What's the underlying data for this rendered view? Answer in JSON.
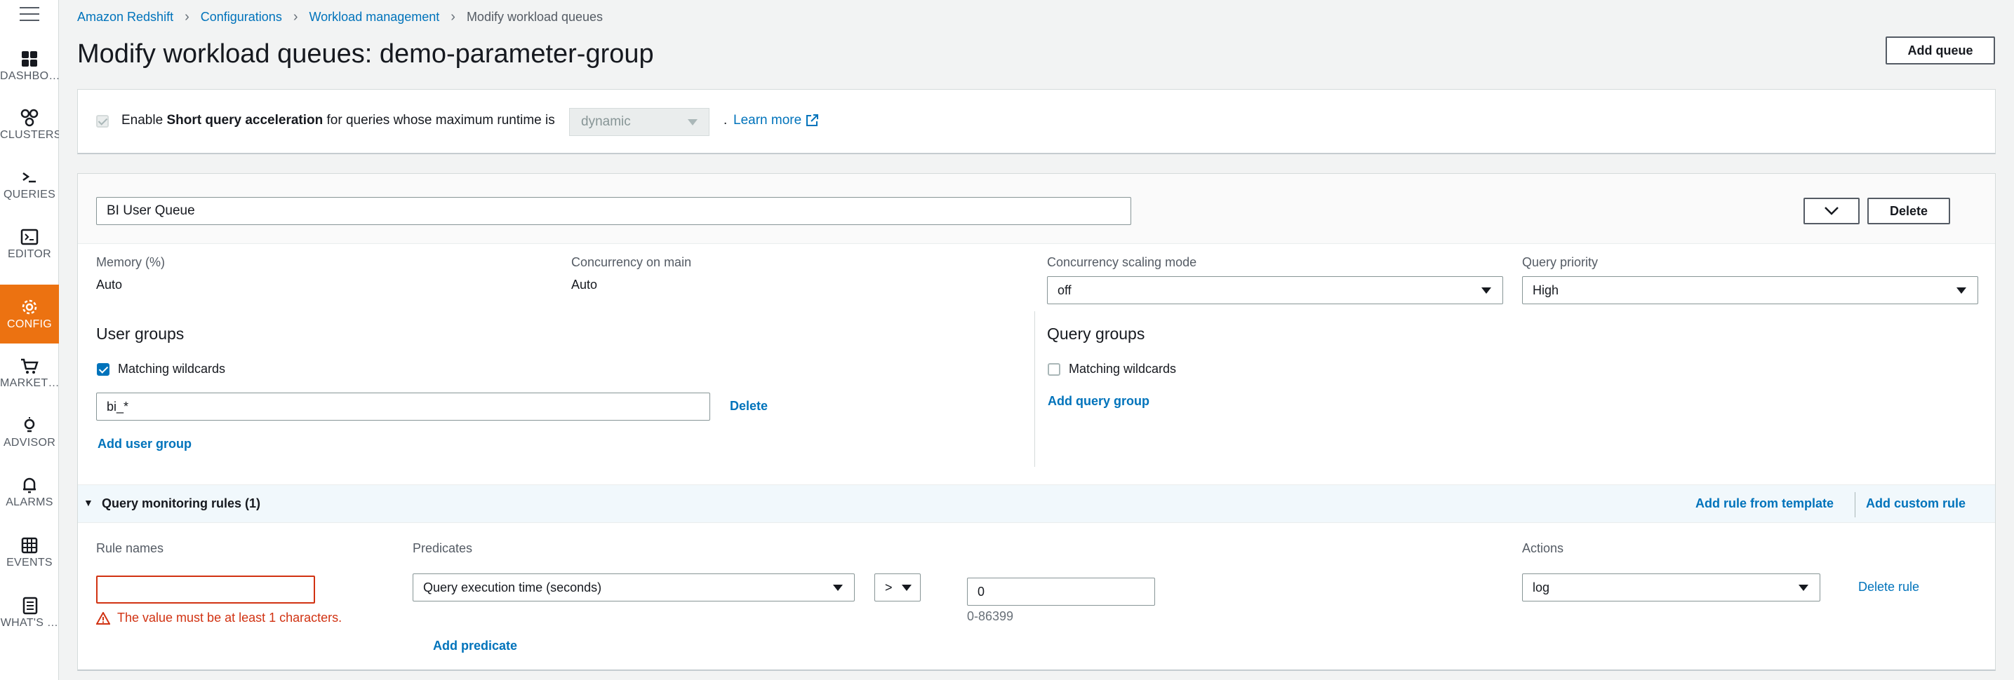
{
  "sidebar": {
    "items": [
      {
        "label": "DASHBO…",
        "icon": "dashboard-icon"
      },
      {
        "label": "CLUSTERS",
        "icon": "clusters-icon"
      },
      {
        "label": "QUERIES",
        "icon": "queries-icon"
      },
      {
        "label": "EDITOR",
        "icon": "editor-icon"
      },
      {
        "label": "CONFIG",
        "icon": "config-gear-icon",
        "active": true
      },
      {
        "label": "MARKET…",
        "icon": "marketplace-cart-icon"
      },
      {
        "label": "ADVISOR",
        "icon": "advisor-bulb-icon"
      },
      {
        "label": "ALARMS",
        "icon": "alarms-bell-icon"
      },
      {
        "label": "EVENTS",
        "icon": "events-calendar-icon"
      },
      {
        "label": "WHAT'S …",
        "icon": "whats-new-icon"
      }
    ]
  },
  "breadcrumb": {
    "items": [
      "Amazon Redshift",
      "Configurations",
      "Workload management"
    ],
    "current": "Modify workload queues"
  },
  "header": {
    "title": "Modify workload queues: demo-parameter-group",
    "add_queue_label": "Add queue"
  },
  "sqa": {
    "enable_label": "Enable ",
    "bold_label": "Short query acceleration",
    "rest_label": " for queries whose maximum runtime is",
    "runtime_value": "dynamic",
    "dot": ".",
    "learn_more": "Learn more"
  },
  "queue": {
    "name": "BI User Queue",
    "delete_label": "Delete",
    "memory_label": "Memory (%)",
    "memory_value": "Auto",
    "concurrency_label": "Concurrency on main",
    "concurrency_value": "Auto",
    "scaling_label": "Concurrency scaling mode",
    "scaling_value": "off",
    "priority_label": "Query priority",
    "priority_value": "High",
    "user_groups": {
      "title": "User groups",
      "wildcards_label": "Matching wildcards",
      "wildcards_checked": true,
      "group_value": "bi_*",
      "delete_label": "Delete",
      "add_label": "Add user group"
    },
    "query_groups": {
      "title": "Query groups",
      "wildcards_label": "Matching wildcards",
      "wildcards_checked": false,
      "add_label": "Add query group"
    }
  },
  "qmr": {
    "title": "Query monitoring rules (1)",
    "add_from_template": "Add rule from template",
    "add_custom": "Add custom rule",
    "rule_names_label": "Rule names",
    "rule_name_value": "",
    "error_text": "The value must be at least 1 characters.",
    "predicates_label": "Predicates",
    "predicate_metric": "Query execution time (seconds)",
    "predicate_operator": ">",
    "predicate_value": "0",
    "predicate_range": "0-86399",
    "add_predicate": "Add predicate",
    "actions_label": "Actions",
    "action_value": "log",
    "delete_rule": "Delete rule"
  },
  "colors": {
    "accent": "#ec7211",
    "link": "#0073bb",
    "error": "#d13212"
  }
}
